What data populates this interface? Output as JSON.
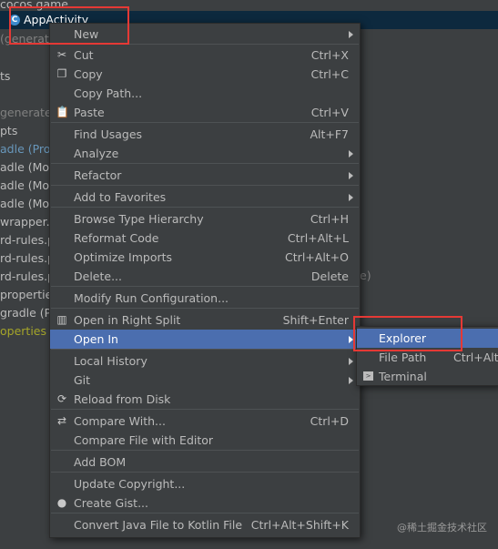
{
  "project_tree": {
    "top_item": "cocos.game",
    "selected_item": "AppActivity",
    "rows": [
      {
        "text": "(generate",
        "style": "dim"
      },
      {
        "text": "",
        "style": "plain"
      },
      {
        "text": "ts",
        "style": "plain"
      },
      {
        "text": "",
        "style": "plain"
      },
      {
        "text": "generated",
        "style": "dim"
      },
      {
        "text": "pts",
        "style": "plain"
      },
      {
        "text": "adle (Proj",
        "style": "blue"
      },
      {
        "text": "adle (Mod",
        "style": "plain"
      },
      {
        "text": "adle (Mod",
        "style": "plain"
      },
      {
        "text": "adle (Mod",
        "style": "plain"
      },
      {
        "text": "wrapper.p",
        "style": "plain"
      },
      {
        "text": "rd-rules.p",
        "style": "plain"
      },
      {
        "text": "rd-rules.p",
        "style": "plain"
      },
      {
        "text": "rd-rules.p",
        "style": "plain"
      },
      {
        "text": "properties",
        "style": "plain"
      },
      {
        "text": "gradle (P",
        "style": "plain"
      },
      {
        "text": "operties (S",
        "style": "yellow"
      }
    ],
    "trailing_text": "e)"
  },
  "context_menu": {
    "items": [
      {
        "label": "New",
        "shortcut": "",
        "submenu": true,
        "icon": ""
      },
      {
        "label": "Cut",
        "shortcut": "Ctrl+X",
        "submenu": false,
        "icon": "scissors-icon"
      },
      {
        "label": "Copy",
        "shortcut": "Ctrl+C",
        "submenu": false,
        "icon": "copy-icon"
      },
      {
        "label": "Copy Path...",
        "shortcut": "",
        "submenu": false,
        "icon": ""
      },
      {
        "label": "Paste",
        "shortcut": "Ctrl+V",
        "submenu": false,
        "icon": "clipboard-icon"
      },
      {
        "label": "Find Usages",
        "shortcut": "Alt+F7",
        "submenu": false,
        "icon": ""
      },
      {
        "label": "Analyze",
        "shortcut": "",
        "submenu": true,
        "icon": ""
      },
      {
        "label": "Refactor",
        "shortcut": "",
        "submenu": true,
        "icon": ""
      },
      {
        "label": "Add to Favorites",
        "shortcut": "",
        "submenu": true,
        "icon": ""
      },
      {
        "label": "Browse Type Hierarchy",
        "shortcut": "Ctrl+H",
        "submenu": false,
        "icon": ""
      },
      {
        "label": "Reformat Code",
        "shortcut": "Ctrl+Alt+L",
        "submenu": false,
        "icon": ""
      },
      {
        "label": "Optimize Imports",
        "shortcut": "Ctrl+Alt+O",
        "submenu": false,
        "icon": ""
      },
      {
        "label": "Delete...",
        "shortcut": "Delete",
        "submenu": false,
        "icon": ""
      },
      {
        "label": "Modify Run Configuration...",
        "shortcut": "",
        "submenu": false,
        "icon": ""
      },
      {
        "label": "Open in Right Split",
        "shortcut": "Shift+Enter",
        "submenu": false,
        "icon": "split-icon"
      },
      {
        "label": "Open In",
        "shortcut": "",
        "submenu": true,
        "icon": ""
      },
      {
        "label": "Local History",
        "shortcut": "",
        "submenu": true,
        "icon": ""
      },
      {
        "label": "Git",
        "shortcut": "",
        "submenu": true,
        "icon": ""
      },
      {
        "label": "Reload from Disk",
        "shortcut": "",
        "submenu": false,
        "icon": "reload-icon"
      },
      {
        "label": "Compare With...",
        "shortcut": "Ctrl+D",
        "submenu": false,
        "icon": "compare-icon"
      },
      {
        "label": "Compare File with Editor",
        "shortcut": "",
        "submenu": false,
        "icon": ""
      },
      {
        "label": "Add BOM",
        "shortcut": "",
        "submenu": false,
        "icon": ""
      },
      {
        "label": "Update Copyright...",
        "shortcut": "",
        "submenu": false,
        "icon": ""
      },
      {
        "label": "Create Gist...",
        "shortcut": "",
        "submenu": false,
        "icon": "github-icon"
      },
      {
        "label": "Convert Java File to Kotlin File",
        "shortcut": "Ctrl+Alt+Shift+K",
        "submenu": false,
        "icon": ""
      }
    ],
    "active_item": "Open In"
  },
  "open_in_submenu": {
    "items": [
      {
        "label": "Explorer",
        "shortcut": ""
      },
      {
        "label": "File Path",
        "shortcut": "Ctrl+Alt+"
      },
      {
        "label": "Terminal",
        "shortcut": ""
      }
    ],
    "active_item": "Explorer"
  },
  "watermark": "@稀土掘金技术社区",
  "colors": {
    "menu_bg": "#3c3f41",
    "selection": "#4b6eaf",
    "highlight_box": "#e53935"
  }
}
